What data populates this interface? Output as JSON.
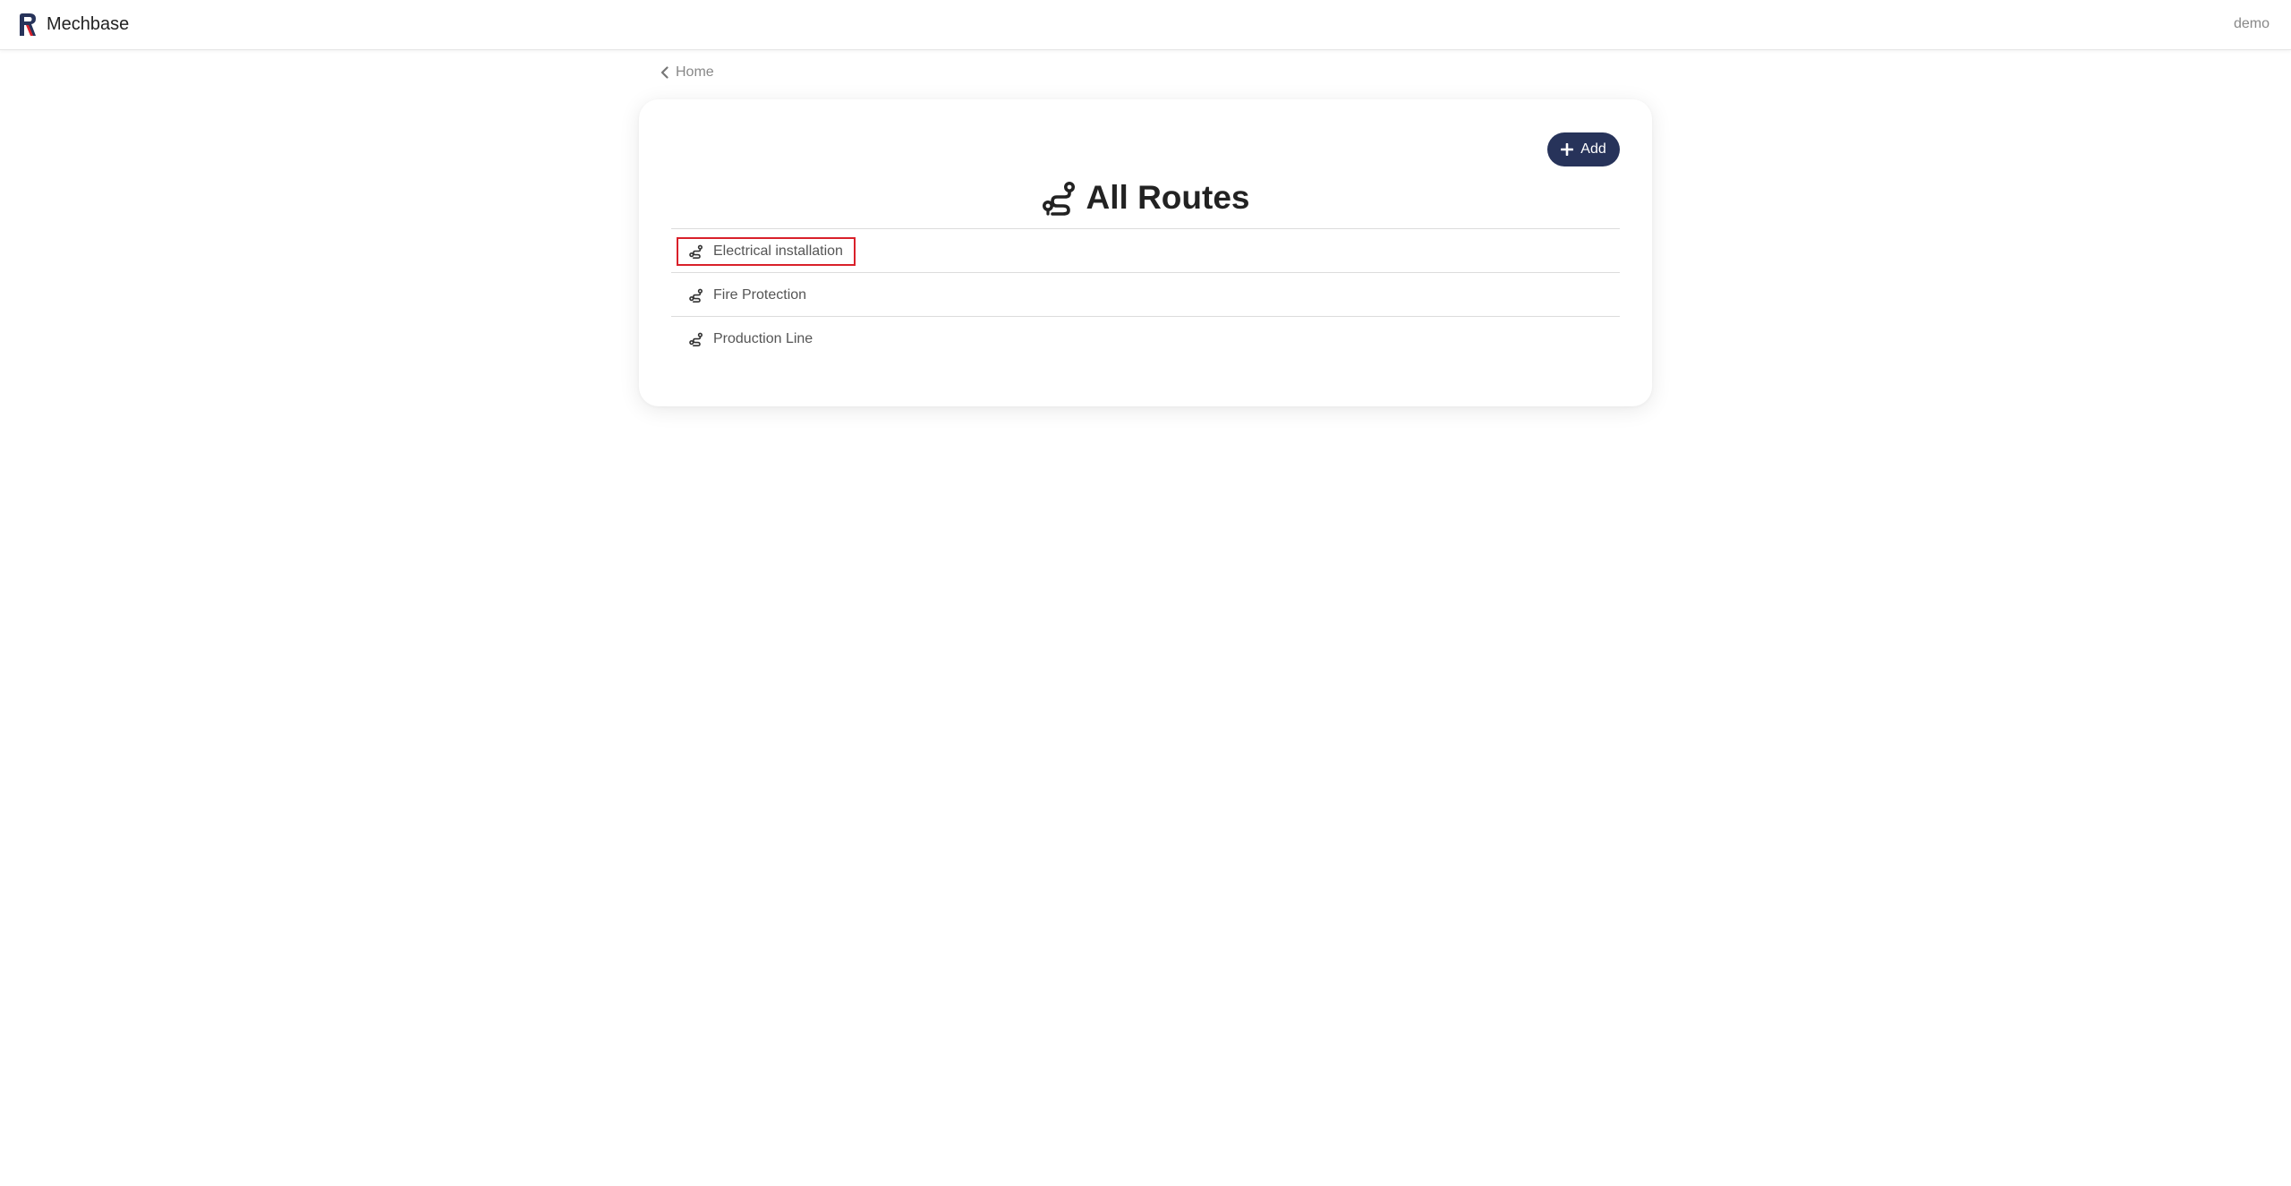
{
  "navbar": {
    "brand_name": "Mechbase",
    "user_name": "demo",
    "brand_colors": [
      "#27335a",
      "#d9202a"
    ]
  },
  "breadcrumb": {
    "label": "Home",
    "icon": "chevron-left-icon"
  },
  "card": {
    "add_button_label": "Add",
    "add_button_icon": "plus-icon",
    "title": "All Routes",
    "title_icon": "route-icon",
    "accent_color": "#27335a"
  },
  "routes": [
    {
      "label": "Electrical installation",
      "icon": "route-icon",
      "highlighted": true
    },
    {
      "label": "Fire Protection",
      "icon": "route-icon",
      "highlighted": false
    },
    {
      "label": "Production Line",
      "icon": "route-icon",
      "highlighted": false
    }
  ]
}
